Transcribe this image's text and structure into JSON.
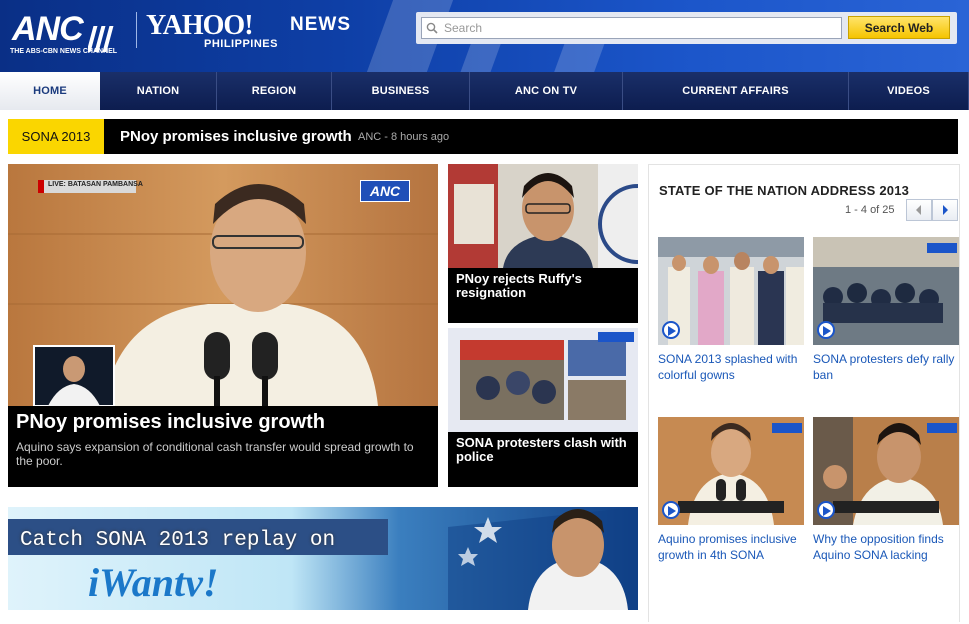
{
  "header": {
    "anc_logo_text": "ANC",
    "anc_subtext": "THE ABS-CBN NEWS CHANNEL",
    "yahoo_logo_text": "YAHOO!",
    "news_text": "NEWS",
    "country_text": "PHILIPPINES"
  },
  "search": {
    "placeholder": "Search",
    "button_label": "Search Web"
  },
  "nav": {
    "items": [
      {
        "label": "HOME"
      },
      {
        "label": "NATION"
      },
      {
        "label": "REGION"
      },
      {
        "label": "BUSINESS"
      },
      {
        "label": "ANC ON TV"
      },
      {
        "label": "CURRENT AFFAIRS"
      },
      {
        "label": "VIDEOS"
      }
    ]
  },
  "ticker": {
    "badge": "SONA 2013",
    "headline": "PNoy promises inclusive growth",
    "meta": "ANC - 8 hours ago"
  },
  "main_story": {
    "title": "PNoy promises inclusive growth",
    "summary": "Aquino says expansion of conditional cash transfer would spread growth to the poor.",
    "live_label": "LIVE: BATASAN PAMBANSA",
    "channel_logo": "ANC"
  },
  "side_stories": [
    {
      "title": "PNoy rejects Ruffy's resignation"
    },
    {
      "title": "SONA protesters clash with police"
    }
  ],
  "promo": {
    "title": "Catch SONA 2013 replay on",
    "logo_text": "iWantv!"
  },
  "right_column": {
    "title": "STATE OF THE NATION ADDRESS 2013",
    "pagination": "1 - 4 of 25",
    "items": [
      {
        "caption": "SONA 2013 splashed with colorful gowns"
      },
      {
        "caption": "SONA protesters defy rally ban"
      },
      {
        "caption": "Aquino promises inclusive growth in 4th SONA"
      },
      {
        "caption": "Why the opposition finds Aquino SONA lacking"
      }
    ]
  },
  "colors": {
    "header_blue": "#0e3fa6",
    "nav_navy": "#13265c",
    "ticker_yellow": "#fad600",
    "search_button": "#f5c400",
    "link_blue": "#1a58b8"
  }
}
